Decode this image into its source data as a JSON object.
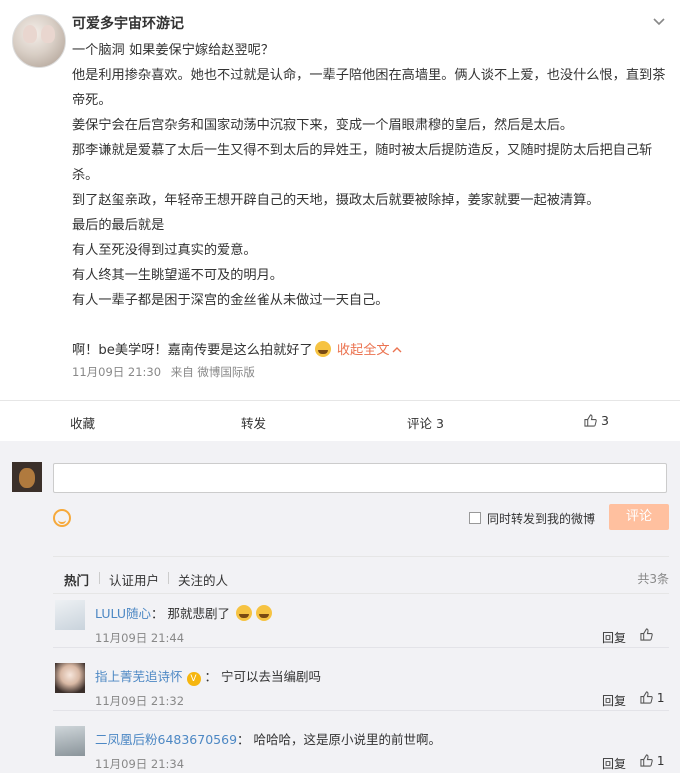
{
  "post": {
    "username": "可爱多宇宙环游记",
    "lines": [
      "一个脑洞 如果姜保宁嫁给赵翌呢？",
      "他是利用掺杂喜欢。她也不过就是认命，一辈子陪他困在高墙里。俩人谈不上爱，也没什么恨，直到茶帝死。",
      "姜保宁会在后宫杂务和国家动荡中沉寂下来，变成一个眉眼肃穆的皇后，然后是太后。",
      "那李谦就是爱慕了太后一生又得不到太后的异姓王，随时被太后提防造反，又随时提防太后把自己斩杀。",
      "到了赵玺亲政，年轻帝王想开辟自己的天地，摄政太后就要被除掉，姜家就要一起被清算。",
      "最后的最后就是",
      "有人至死没得到过真实的爱意。",
      "有人终其一生眺望遥不可及的明月。",
      "有人一辈子都是困于深宫的金丝雀从未做过一天自己。"
    ],
    "closing_text": "啊！be美学呀！嘉南传要是这么拍就好了",
    "collapse_link": "收起全文",
    "time": "11月09日 21:30",
    "source": "来自 微博国际版"
  },
  "actions": {
    "favorite": "收藏",
    "repost": "转发",
    "comment": "评论 3",
    "like_count": "3"
  },
  "composer": {
    "placeholder": "",
    "repost_checkbox_label": "同时转发到我的微博",
    "submit_label": "评论"
  },
  "comment_tabs": {
    "tabs": [
      "热门",
      "认证用户",
      "关注的人"
    ],
    "total": "共3条"
  },
  "comments": [
    {
      "name": "LULU随心",
      "text": "那就悲剧了",
      "time": "11月09日 21:44",
      "reply": "回复",
      "likes": ""
    },
    {
      "name": "指上菁芜追诗怀",
      "text": "宁可以去当编剧吗",
      "time": "11月09日 21:32",
      "reply": "回复",
      "likes": "1"
    },
    {
      "name": "二凤凰后粉6483670569",
      "text": "哈哈哈，这是原小说里的前世啊。",
      "time": "11月09日 21:34",
      "reply": "回复",
      "likes": "1"
    }
  ],
  "colors": {
    "link": "#eb7350",
    "username": "#4d88c4",
    "submit_bg": "#ffc09f",
    "verified": "#f6b60f"
  }
}
